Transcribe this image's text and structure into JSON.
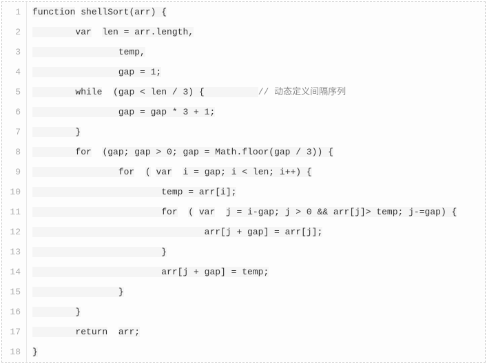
{
  "lines": [
    {
      "num": "1",
      "segs": [
        [
          "function",
          true
        ],
        [
          " ",
          false
        ],
        [
          "shellSort",
          true
        ],
        [
          "(arr) {",
          true
        ]
      ]
    },
    {
      "num": "2",
      "segs": [
        [
          "        ",
          true
        ],
        [
          "var",
          true
        ],
        [
          "  ",
          false
        ],
        [
          "len = arr.length,",
          true
        ]
      ]
    },
    {
      "num": "3",
      "segs": [
        [
          "                ",
          true
        ],
        [
          "temp,",
          true
        ]
      ]
    },
    {
      "num": "4",
      "segs": [
        [
          "                ",
          true
        ],
        [
          "gap = 1;",
          true
        ]
      ]
    },
    {
      "num": "5",
      "segs": [
        [
          "        ",
          true
        ],
        [
          "while",
          true
        ],
        [
          "  ",
          false
        ],
        [
          "(gap < len / 3) {          ",
          true
        ],
        [
          "// 动态定义间隔序列",
          false,
          true
        ]
      ]
    },
    {
      "num": "6",
      "segs": [
        [
          "                ",
          true
        ],
        [
          "gap = gap * 3 + 1;",
          true
        ]
      ]
    },
    {
      "num": "7",
      "segs": [
        [
          "        ",
          true
        ],
        [
          "}",
          true
        ]
      ]
    },
    {
      "num": "8",
      "segs": [
        [
          "        ",
          true
        ],
        [
          "for",
          true
        ],
        [
          "  ",
          false
        ],
        [
          "(gap; gap > 0; gap = Math.floor(gap / 3)) {",
          true
        ]
      ]
    },
    {
      "num": "9",
      "segs": [
        [
          "                ",
          true
        ],
        [
          "for",
          true
        ],
        [
          "  ",
          false
        ],
        [
          "(",
          true
        ],
        [
          " ",
          false
        ],
        [
          "var",
          true
        ],
        [
          "  ",
          false
        ],
        [
          "i = gap; i < len; i++) {",
          true
        ]
      ]
    },
    {
      "num": "10",
      "segs": [
        [
          "                        ",
          true
        ],
        [
          "temp = arr[i];",
          true
        ]
      ]
    },
    {
      "num": "11",
      "segs": [
        [
          "                        ",
          true
        ],
        [
          "for",
          true
        ],
        [
          "  ",
          false
        ],
        [
          "(",
          true
        ],
        [
          " ",
          false
        ],
        [
          "var",
          true
        ],
        [
          "  ",
          false
        ],
        [
          "j = i-gap; j > 0 && arr[j]> temp; j-=gap) {",
          true
        ]
      ]
    },
    {
      "num": "12",
      "segs": [
        [
          "                                ",
          true
        ],
        [
          "arr[j + gap] = arr[j];",
          true
        ]
      ]
    },
    {
      "num": "13",
      "segs": [
        [
          "                        ",
          true
        ],
        [
          "}",
          true
        ]
      ]
    },
    {
      "num": "14",
      "segs": [
        [
          "                        ",
          true
        ],
        [
          "arr[j + gap] = temp;",
          true
        ]
      ]
    },
    {
      "num": "15",
      "segs": [
        [
          "                ",
          true
        ],
        [
          "}",
          true
        ]
      ]
    },
    {
      "num": "16",
      "segs": [
        [
          "        ",
          true
        ],
        [
          "}",
          true
        ]
      ]
    },
    {
      "num": "17",
      "segs": [
        [
          "        ",
          true
        ],
        [
          "return",
          true
        ],
        [
          "  ",
          false
        ],
        [
          "arr;",
          true
        ]
      ]
    },
    {
      "num": "18",
      "segs": [
        [
          "}",
          true
        ]
      ]
    }
  ]
}
